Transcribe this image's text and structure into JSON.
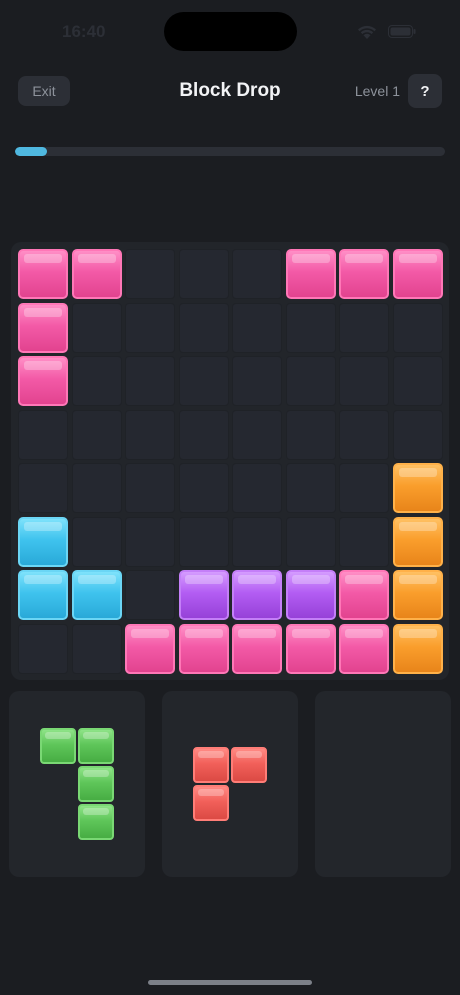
{
  "status_bar": {
    "time": "16:40"
  },
  "header": {
    "exit_label": "Exit",
    "title": "Block Drop",
    "level_label": "Level 1",
    "help_label": "?"
  },
  "progress": {
    "value": 0.075,
    "color": "#4fb8e0"
  },
  "board": {
    "rows": 8,
    "cols": 8,
    "grid": [
      [
        "pink",
        "pink",
        null,
        null,
        null,
        "pink",
        "pink",
        "pink"
      ],
      [
        "pink",
        null,
        null,
        null,
        null,
        null,
        null,
        null
      ],
      [
        "pink",
        null,
        null,
        null,
        null,
        null,
        null,
        null
      ],
      [
        null,
        null,
        null,
        null,
        null,
        null,
        null,
        null
      ],
      [
        null,
        null,
        null,
        null,
        null,
        null,
        null,
        "orange"
      ],
      [
        "cyan",
        null,
        null,
        null,
        null,
        null,
        null,
        "orange"
      ],
      [
        "cyan",
        "cyan",
        null,
        "purple",
        "purple",
        "purple",
        "pink",
        "orange"
      ],
      [
        null,
        null,
        "pink",
        "pink",
        "pink",
        "pink",
        "pink",
        "orange"
      ]
    ]
  },
  "tray": {
    "pieces": [
      {
        "color": "green",
        "cells": [
          [
            0,
            0
          ],
          [
            0,
            1
          ],
          [
            1,
            1
          ],
          [
            2,
            1
          ]
        ]
      },
      {
        "color": "red",
        "cells": [
          [
            0,
            0
          ],
          [
            0,
            1
          ],
          [
            1,
            0
          ]
        ]
      },
      null
    ]
  },
  "colors": {
    "pink": "#f35aa7",
    "cyan": "#3fc3ee",
    "purple": "#b35df3",
    "orange": "#fa9e2c",
    "green": "#5fc65a",
    "red": "#f2605a",
    "background": "#1b1d21"
  }
}
